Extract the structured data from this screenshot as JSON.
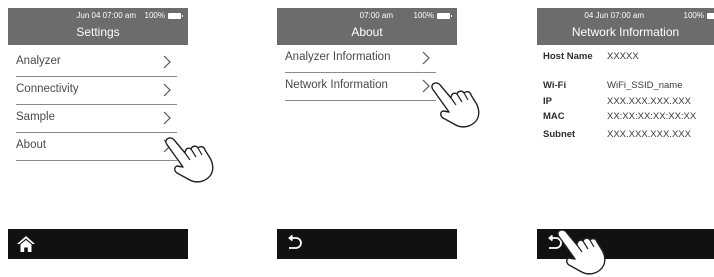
{
  "settings": {
    "status_time": "Jun 04  07:00 am",
    "status_battery": "100%",
    "title": "Settings",
    "items": [
      {
        "label": "Analyzer"
      },
      {
        "label": "Connectivity"
      },
      {
        "label": "Sample"
      },
      {
        "label": "About"
      }
    ],
    "bottom_icon": "home-icon"
  },
  "about": {
    "status_time": "07:00 am",
    "status_battery": "100%",
    "title": "About",
    "items": [
      {
        "label": "Analyzer Information"
      },
      {
        "label": "Network Information"
      }
    ],
    "bottom_icon": "back-icon"
  },
  "network": {
    "status_time": "04 Jun  07:00 am",
    "status_battery": "100%",
    "title": "Network Information",
    "rows": [
      {
        "key": "Host Name",
        "value": "XXXXX"
      },
      {
        "key": "Wi-Fi",
        "value": "WiFi_SSID_name"
      },
      {
        "key": "IP",
        "value": "XXX.XXX.XXX.XXX"
      },
      {
        "key": "MAC",
        "value": "XX:XX:XX:XX:XX:XX"
      },
      {
        "key": "Subnet",
        "value": "XXX.XXX.XXX.XXX"
      }
    ],
    "bottom_icon": "back-icon"
  },
  "colors": {
    "status_bar": "#6c6c6c",
    "bottom_bar": "#111111",
    "divider": "#8a8a8a"
  },
  "icons": [
    "chevron-right-icon",
    "home-icon",
    "back-icon",
    "pointing-hand-icon",
    "battery-icon"
  ]
}
